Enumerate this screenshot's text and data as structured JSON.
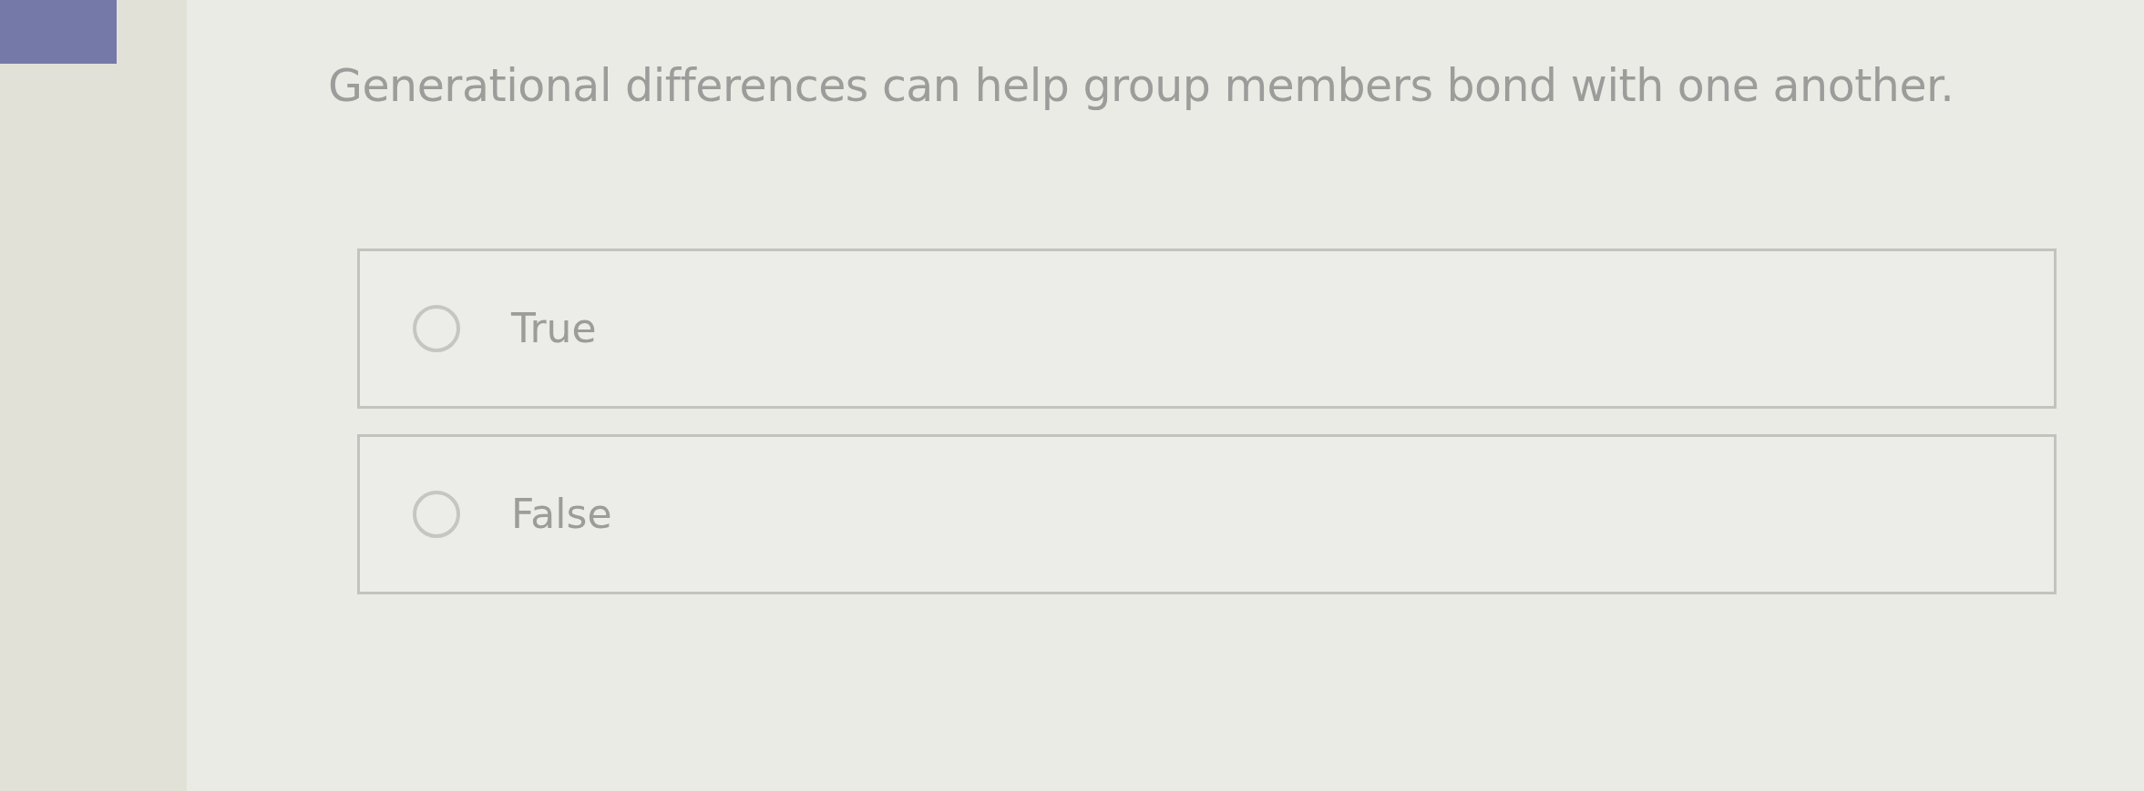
{
  "question": "Generational differences can help group members bond with one another.",
  "options": [
    {
      "label": "True",
      "selected": false
    },
    {
      "label": "False",
      "selected": false
    }
  ]
}
